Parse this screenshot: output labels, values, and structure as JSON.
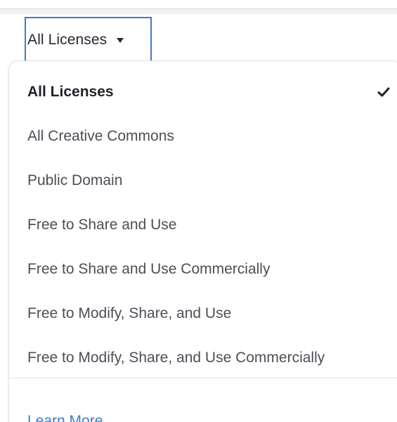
{
  "license_filter": {
    "selected_label": "All Licenses",
    "caret_icon": "caret-down-icon"
  },
  "menu": {
    "items": [
      {
        "label": "All Licenses",
        "selected": true
      },
      {
        "label": "All Creative Commons",
        "selected": false
      },
      {
        "label": "Public Domain",
        "selected": false
      },
      {
        "label": "Free to Share and Use",
        "selected": false
      },
      {
        "label": "Free to Share and Use Commercially",
        "selected": false
      },
      {
        "label": "Free to Modify, Share, and Use",
        "selected": false
      },
      {
        "label": "Free to Modify, Share, and Use Commercially",
        "selected": false
      }
    ],
    "check_icon": "checkmark-icon",
    "learn_more_label": "Learn More"
  },
  "colors": {
    "accent": "#3d7cc9",
    "text_primary": "#1d2228",
    "text_secondary": "#4b4f56"
  }
}
